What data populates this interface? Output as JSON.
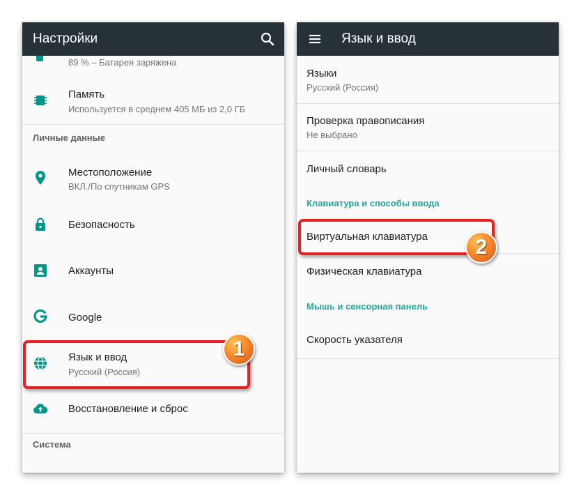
{
  "left_screen": {
    "title": "Настройки",
    "top_item": {
      "subtitle": "89 % – Батарея заряжена"
    },
    "memory": {
      "title": "Память",
      "subtitle": "Используется в среднем 405 МБ из 2,0 ГБ"
    },
    "section_personal": "Личные данные",
    "location": {
      "title": "Местоположение",
      "subtitle": "ВКЛ./По спутникам GPS"
    },
    "security": {
      "title": "Безопасность"
    },
    "accounts": {
      "title": "Аккаунты"
    },
    "google": {
      "title": "Google"
    },
    "language": {
      "title": "Язык и ввод",
      "subtitle": "Русский (Россия)"
    },
    "backup": {
      "title": "Восстановление и сброс"
    },
    "section_system": "Система"
  },
  "right_screen": {
    "title": "Язык и ввод",
    "languages": {
      "title": "Языки",
      "subtitle": "Русский (Россия)"
    },
    "spellcheck": {
      "title": "Проверка правописания",
      "subtitle": "Не выбрано"
    },
    "dictionary": {
      "title": "Личный словарь"
    },
    "section_keyboard": "Клавиатура и способы ввода",
    "virtual_keyboard": {
      "title": "Виртуальная клавиатура"
    },
    "physical_keyboard": {
      "title": "Физическая клавиатура"
    },
    "section_mouse": "Мышь и сенсорная панель",
    "pointer_speed": {
      "title": "Скорость указателя"
    }
  },
  "annotations": {
    "badge_1": "1",
    "badge_2": "2"
  },
  "colors": {
    "appbar": "#263238",
    "accent_teal": "#009688",
    "highlight_red": "#e52222",
    "badge_orange": "#f6892b"
  }
}
